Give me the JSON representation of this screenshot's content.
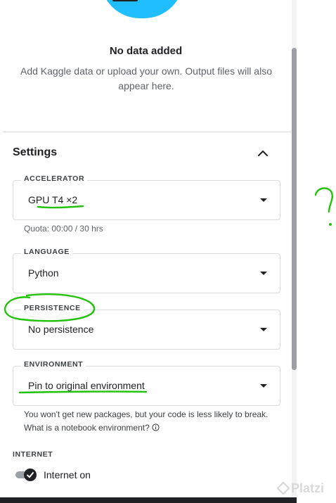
{
  "empty_state": {
    "title": "No data added",
    "description": "Add Kaggle data or upload your own. Output files will also appear here."
  },
  "settings": {
    "title": "Settings",
    "accelerator": {
      "label": "ACCELERATOR",
      "value": "GPU T4 ×2",
      "quota": "Quota: 00:00 / 30 hrs"
    },
    "language": {
      "label": "LANGUAGE",
      "value": "Python"
    },
    "persistence": {
      "label": "PERSISTENCE",
      "value": "No persistence"
    },
    "environment": {
      "label": "ENVIRONMENT",
      "value": "Pin to original environment",
      "help": "You won't get new packages, but your code is less likely to break. What is a notebook environment?"
    },
    "internet": {
      "label": "INTERNET",
      "value": "Internet on",
      "enabled": true
    }
  },
  "annotation": {
    "question_mark": "?"
  },
  "watermark": {
    "text": "Platzi"
  },
  "colors": {
    "accent": "#20beff",
    "annotation_green": "#22c20a",
    "text": "#202124"
  }
}
